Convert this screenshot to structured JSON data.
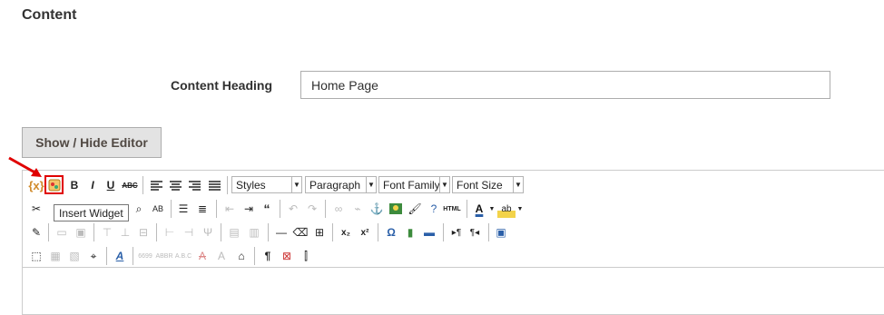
{
  "section": {
    "title": "Content"
  },
  "content_heading": {
    "label": "Content Heading",
    "value": "Home Page"
  },
  "show_hide_editor": {
    "label": "Show / Hide Editor"
  },
  "toolbar": {
    "styles_select": "Styles",
    "paragraph_select": "Paragraph",
    "font_family_select": "Font Family",
    "font_size_select": "Font Size",
    "insert_widget_tooltip": "Insert Widget",
    "highlight_color": "#e00000",
    "icons": {
      "magento_variable": "variable-icon",
      "insert_widget": "insert-widget-icon",
      "bold": "B",
      "italic": "I",
      "underline": "U",
      "strikethrough": "ABC",
      "html": "HTML",
      "nonbreaking_space": "¶"
    }
  }
}
